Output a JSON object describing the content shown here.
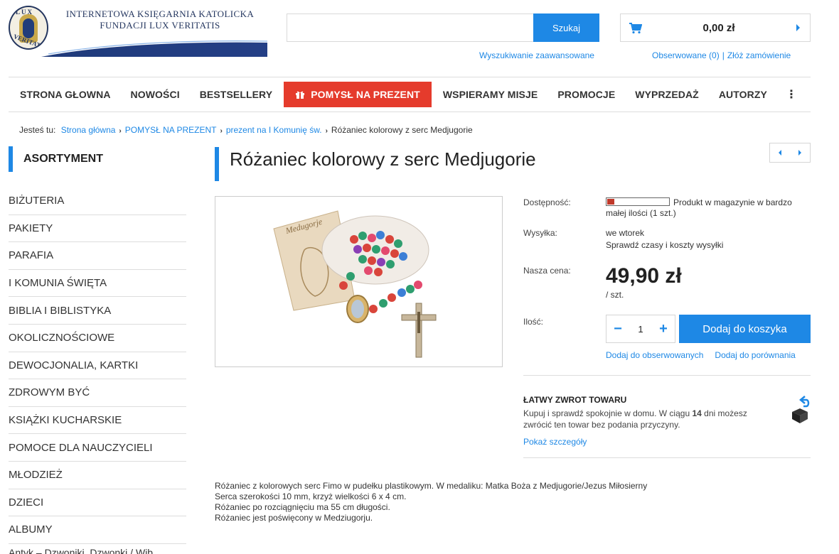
{
  "logo": {
    "line1": "INTERNETOWA KSIĘGARNIA KATOLICKA",
    "line2": "FUNDACJI LUX VERITATIS",
    "seal_text_top": "LUX",
    "seal_text_bottom": "VERITATIS"
  },
  "search": {
    "value": "",
    "button_label": "Szukaj",
    "advanced_link": "Wyszukiwanie zaawansowane"
  },
  "cart": {
    "total": "0,00 zł",
    "icon": "cart-icon"
  },
  "header_links": {
    "watched": "Obserwowane (0)",
    "separator": "|",
    "order": "Złóż zamówienie"
  },
  "nav": {
    "items": [
      {
        "label": "STRONA GŁOWNA"
      },
      {
        "label": "NOWOŚCI"
      },
      {
        "label": "BESTSELLERY"
      },
      {
        "label": "POMYSŁ NA PREZENT",
        "highlight": true
      },
      {
        "label": "WSPIERAMY MISJE"
      },
      {
        "label": "PROMOCJE"
      },
      {
        "label": "WYPRZEDAŻ"
      },
      {
        "label": "AUTORZY"
      }
    ],
    "more_icon": "⋮"
  },
  "breadcrumb": {
    "prefix": "Jesteś tu:",
    "links": [
      "Strona główna",
      "POMYSŁ NA PREZENT",
      "prezent na I Komunię św."
    ],
    "current": "Różaniec kolorowy z serc Medjugorie",
    "separator": "›"
  },
  "sidebar": {
    "heading": "ASORTYMENT",
    "items": [
      "BIŻUTERIA",
      "PAKIETY",
      "PARAFIA",
      "I KOMUNIA ŚWIĘTA",
      "BIBLIA I BIBLISTYKA",
      "OKOLICZNOŚCIOWE",
      "DEWOCJONALIA, KARTKI",
      "ZDROWYM BYĆ",
      "KSIĄŻKI KUCHARSKIE",
      "POMOCE DLA NAUCZYCIELI",
      "MŁODZIEŻ",
      "DZIECI",
      "ALBUMY"
    ],
    "cut_item": "Antyk – Dzwoniki, Dzwonki / Wib..."
  },
  "product": {
    "title": "Różaniec kolorowy z serc Medjugorie",
    "image_label": "Medugorje",
    "availability_label": "Dostępność:",
    "availability_text_1": "Produkt w magazynie w bardzo",
    "availability_text_2": "małej ilości (1 szt.)",
    "availability_level": 0.12,
    "shipping_label": "Wysyłka:",
    "shipping_value": "we wtorek",
    "shipping_link": "Sprawdź czasy i koszty wysyłki",
    "price_label": "Nasza cena:",
    "price": "49,90 zł",
    "unit": "/ szt.",
    "qty_label": "Ilość:",
    "qty_value": "1",
    "qty_minus": "−",
    "qty_plus": "+",
    "add_to_cart": "Dodaj do koszyka",
    "add_watch": "Dodaj do obserwowanych",
    "add_compare": "Dodaj do porównania",
    "return_title": "ŁATWY ZWROT TOWARU",
    "return_text_1": "Kupuj i sprawdź spokojnie w domu. W ciągu ",
    "return_days": "14",
    "return_text_2": " dni możesz zwrócić ten towar bez podania przyczyny.",
    "return_link": "Pokaż szczegóły",
    "description": [
      "Różaniec z kolorowych serc Fimo w pudełku plastikowym. W medaliku: Matka Boża z Medjugorie/Jezus Miłosierny",
      "Serca szerokości 10 mm, krzyż wielkości 6 x 4 cm.",
      "Różaniec po rozciągnięciu ma 55 cm długości.",
      "Różaniec jest poświęcony w Medziugorju."
    ]
  },
  "colors": {
    "accent": "#1e88e5",
    "gift": "#e53b2c",
    "brand_navy": "#24365f"
  }
}
